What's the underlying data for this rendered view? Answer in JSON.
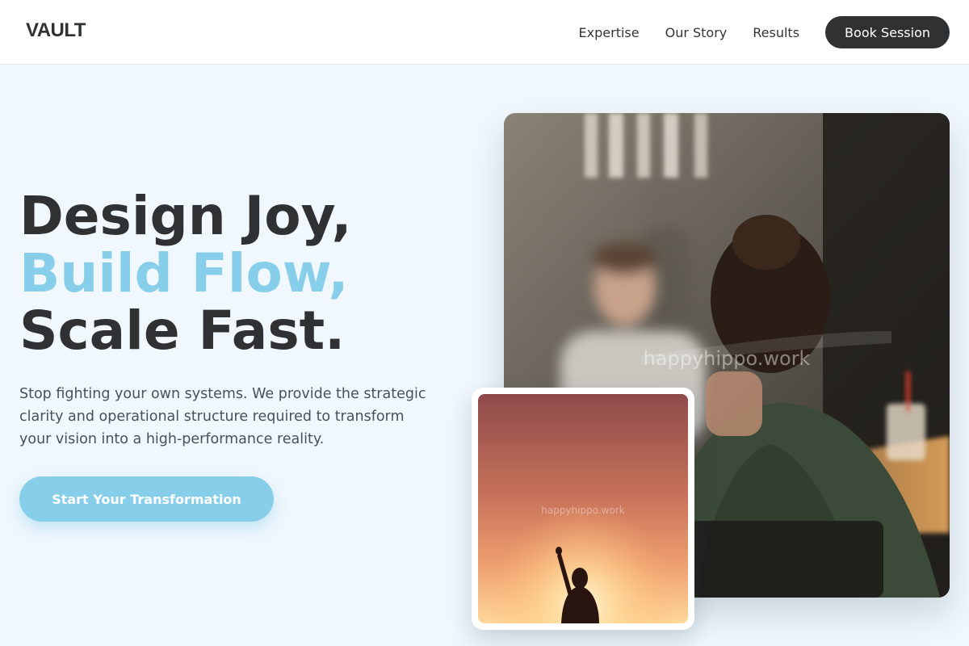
{
  "header": {
    "logo": "VAULT",
    "nav": [
      "Expertise",
      "Our Story",
      "Results"
    ],
    "cta_label": "Book Session"
  },
  "hero": {
    "headline": {
      "line1": "Design Joy,",
      "line2": "Build Flow,",
      "line3": "Scale Fast."
    },
    "lead": "Stop fighting your own systems. We provide the strategic clarity and operational structure required to transform your vision into a high-performance reality.",
    "cta_label": "Start Your Transformation"
  },
  "images": {
    "main_watermark": "happyhippo.work",
    "small_watermark": "happyhippo.work"
  },
  "colors": {
    "accent": "#87ceeb",
    "dark": "#2f3133",
    "background": "#f0f7fd"
  }
}
